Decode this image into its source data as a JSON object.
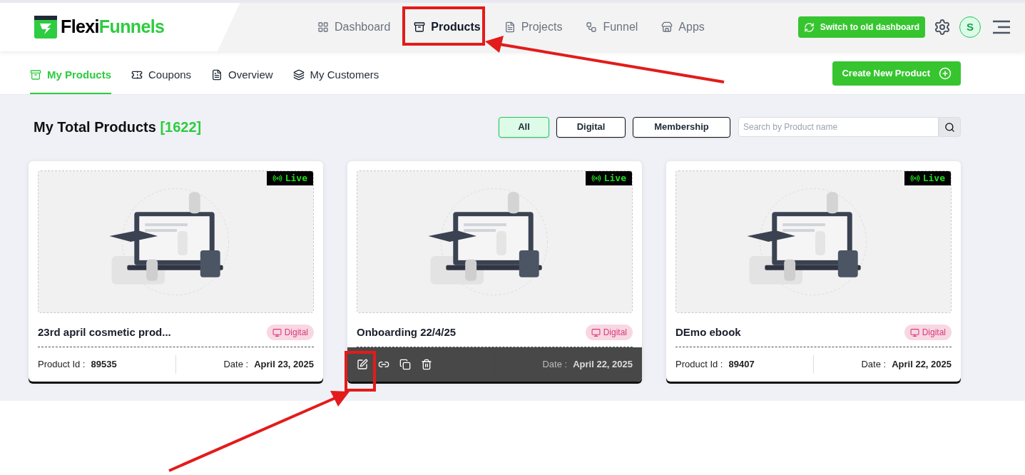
{
  "logo": {
    "part_1": "Flexi",
    "part_2": "Funnels"
  },
  "nav": [
    {
      "label": "Dashboard",
      "selected": false
    },
    {
      "label": "Products",
      "selected": true
    },
    {
      "label": "Projects",
      "selected": false
    },
    {
      "label": "Funnel",
      "selected": false
    },
    {
      "label": "Apps",
      "selected": false
    }
  ],
  "switch_button": "Switch to old dashboard",
  "avatar": "S",
  "subtabs": [
    {
      "label": "My Products",
      "selected": true
    },
    {
      "label": "Coupons",
      "selected": false
    },
    {
      "label": "Overview",
      "selected": false
    },
    {
      "label": "My Customers",
      "selected": false
    }
  ],
  "create_button": "Create New Product",
  "heading": {
    "title": "My Total Products",
    "count": "[1622]"
  },
  "filters": [
    {
      "label": "All",
      "selected": true
    },
    {
      "label": "Digital",
      "selected": false
    },
    {
      "label": "Membership",
      "selected": false
    }
  ],
  "search": {
    "placeholder": "Search by Product name"
  },
  "products": [
    {
      "status": "Live",
      "name": "23rd april cosmetic prod...",
      "type": "Digital",
      "id_label": "Product Id :",
      "id": "89535",
      "date_label": "Date :",
      "date": "April 23, 2025",
      "hovered": false
    },
    {
      "status": "Live",
      "name": "Onboarding 22/4/25",
      "type": "Digital",
      "date_label": "Date :",
      "date": "April 22, 2025",
      "hovered": true
    },
    {
      "status": "Live",
      "name": "DEmo ebook",
      "type": "Digital",
      "id_label": "Product Id :",
      "id": "89407",
      "date_label": "Date :",
      "date": "April 22, 2025",
      "hovered": false
    }
  ]
}
